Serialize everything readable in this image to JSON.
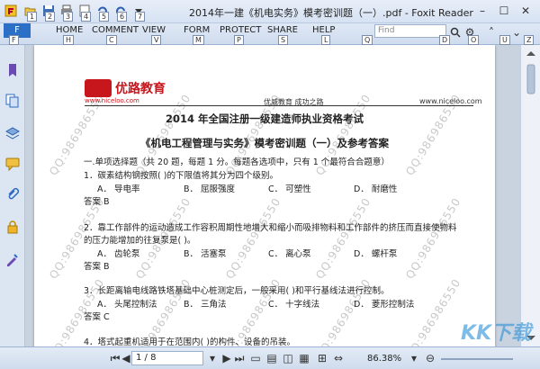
{
  "window": {
    "title": "2014年一建《机电实务》模考密训题（一）.pdf - Foxit Reader"
  },
  "quick_access": [
    "1",
    "2",
    "3",
    "4",
    "5",
    "6",
    "7"
  ],
  "ribbon": {
    "file_label": "F",
    "file_tip": "F",
    "tabs": [
      {
        "label": "HOME",
        "tip": "H"
      },
      {
        "label": "COMMENT",
        "tip": "C"
      },
      {
        "label": "VIEW",
        "tip": "V"
      },
      {
        "label": "FORM",
        "tip": "M"
      },
      {
        "label": "PROTECT",
        "tip": "P"
      },
      {
        "label": "SHARE",
        "tip": "S"
      },
      {
        "label": "HELP",
        "tip": "L"
      }
    ],
    "search_placeholder": "Find",
    "search_tip": "Q",
    "find_tip": "D",
    "gear_tip": "O",
    "up_tip": "U",
    "z_tip": "Z"
  },
  "page": {
    "header_brand": "优路教育",
    "header_site": "www.niceloo.com",
    "header_slogan": "优威教育   成功之路",
    "header_url": "www.niceloo.com",
    "title1": "2014 年全国注册一级建造师执业资格考试",
    "title2": "《机电工程管理与实务》模考密训题（一）及参考答案",
    "intro": "一.单项选择题（共 20 题，每题 1 分。每题各选项中，只有 1 个最符合合题意）",
    "q1": {
      "text": "1．碳素结构钢按照(    )的下限值将其分为四个级别。",
      "a": "A．  导电率",
      "b": "B．  屈服强度",
      "c": "C．  可塑性",
      "d": "D．  耐磨性",
      "answer": "答案 B"
    },
    "q2": {
      "text1": "2．靠工作部件的运动造成工作容积周期性地增大和缩小而吸排物料和工作部件的挤压而直接使物料",
      "text2": "的压力能增加的往复泵是(    )。",
      "a": "A．  齿轮泵",
      "b": "B．  活塞泵",
      "c": "C．  离心泵",
      "d": "D．  螺杆泵",
      "answer": "答案 B"
    },
    "q3": {
      "text": "3．长距离输电线路铁塔基础中心桩测定后，一般采用(    )和平行基线法进行控制。",
      "a": "A．  头尾控制法",
      "b": "B．  三角法",
      "c": "C．  十字线法",
      "d": "D．  菱形控制法",
      "answer": "答案 C"
    },
    "q4": {
      "text": "4．塔式起重机适用于在范围内(    )的构件、设备的吊装。"
    },
    "watermark": "QQ:986986550"
  },
  "statusbar": {
    "page_field": "1 / 8",
    "zoom": "86.38%"
  },
  "overlay_logo": "KK下载"
}
